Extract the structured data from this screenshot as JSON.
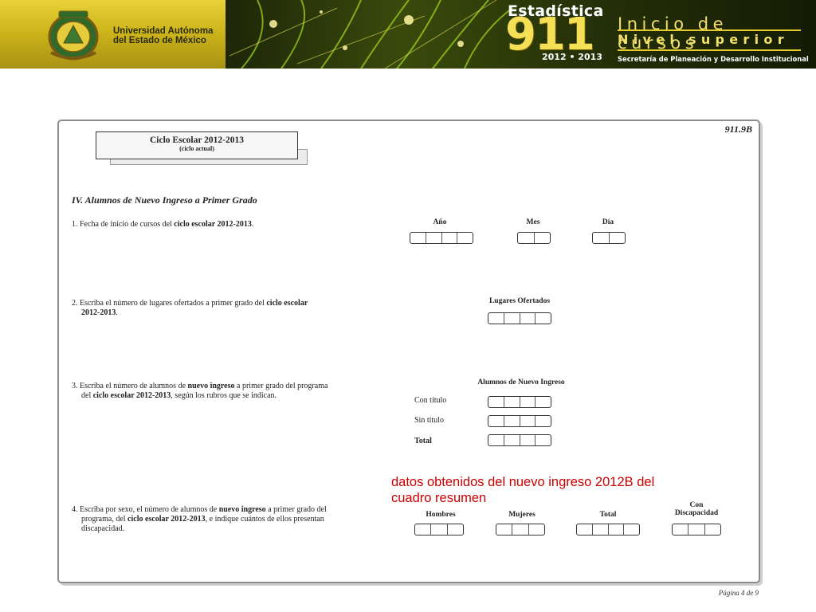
{
  "header": {
    "university_line1": "Universidad Autónoma",
    "university_line2": "del Estado de México",
    "estadistica": "Estadística",
    "big_number": "911",
    "years": "2012 • 2013",
    "inicio": "Inicio de cursos",
    "nivel": "Nivel superior",
    "secretaria": "Secretaría de Planeación y Desarrollo Institucional",
    "crest_icon": "university-crest-icon",
    "colors": {
      "gold": "#cdb51b",
      "dark_green": "#2b3a09",
      "title_yellow": "#f2e06a"
    }
  },
  "form": {
    "code": "911.9B",
    "cycle_title": "Ciclo Escolar 2012-2013",
    "cycle_sub": "(ciclo actual)",
    "section_title": "IV. Alumnos de Nuevo Ingreso a Primer Grado",
    "q1": {
      "prefix": "1. Fecha de inicio de cursos del ",
      "bold": "ciclo escolar 2012-2013",
      "suffix": "."
    },
    "date_labels": {
      "year": "Año",
      "month": "Mes",
      "day": "Día"
    },
    "q2": {
      "line1_prefix": "2. Escriba el número de lugares ofertados a primer grado del ",
      "line1_bold": "ciclo escolar",
      "line2_bold": "2012-2013",
      "line2_suffix": "."
    },
    "lugares_label": "Lugares Ofertados",
    "q3": {
      "line1_prefix": "3. Escriba el número de alumnos de ",
      "line1_bold": "nuevo ingreso",
      "line1_suffix": " a primer grado del programa",
      "line2_prefix": "del ",
      "line2_bold": "ciclo escolar 2012-2013",
      "line2_suffix": ", según los rubros que se indican."
    },
    "nuevo_ingreso_label": "Alumnos de Nuevo Ingreso",
    "rows": {
      "con_titulo": "Con título",
      "sin_titulo": "Sin título",
      "total": "Total"
    },
    "q4": {
      "line1_prefix": "4. Escriba por sexo, el número de alumnos de ",
      "line1_bold": "nuevo ingreso",
      "line1_suffix": " a primer grado del",
      "line2_prefix": "programa, del ",
      "line2_bold": "ciclo escolar 2012-2013",
      "line2_suffix": ", e indique cuántos de ellos presentan",
      "line3": "discapacidad."
    },
    "sex_labels": {
      "hombres": "Hombres",
      "mujeres": "Mujeres",
      "total": "Total",
      "con": "Con",
      "discapacidad": "Discapacidad"
    },
    "page": "Página 4 de 9"
  },
  "note": {
    "line1": "datos obtenidos del nuevo ingreso 2012B del",
    "line2": "cuadro resumen",
    "color": "#cc0000"
  }
}
